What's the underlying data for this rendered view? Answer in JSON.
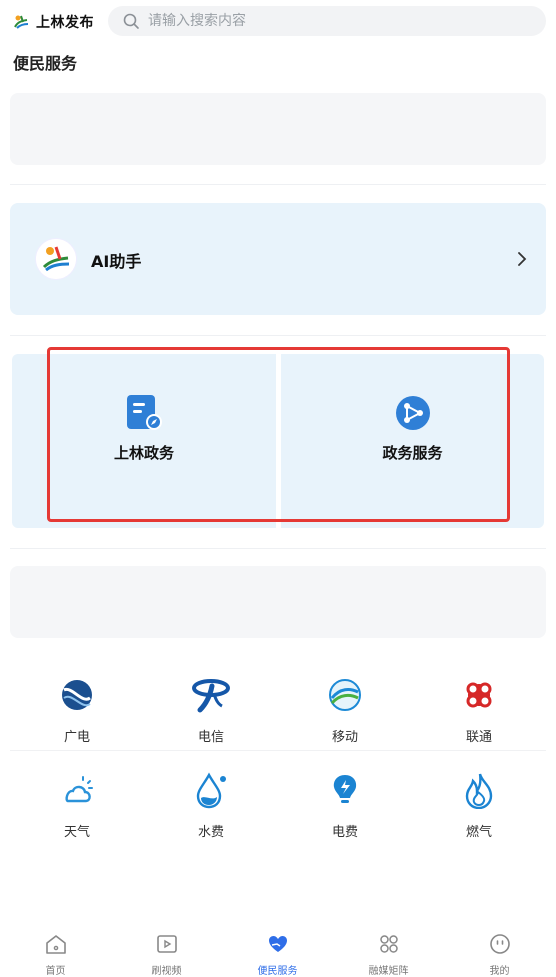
{
  "header": {
    "brand": "上林发布",
    "search_placeholder": "请输入搜索内容"
  },
  "section_title": "便民服务",
  "ai_card": {
    "label": "AI助手"
  },
  "services": [
    {
      "label": "上林政务",
      "icon": "document-compass-icon"
    },
    {
      "label": "政务服务",
      "icon": "share-network-icon"
    }
  ],
  "utilities_row1": [
    {
      "label": "广电",
      "icon": "broadcast-tv-icon"
    },
    {
      "label": "电信",
      "icon": "china-telecom-icon"
    },
    {
      "label": "移动",
      "icon": "china-mobile-icon"
    },
    {
      "label": "联通",
      "icon": "china-unicom-icon"
    }
  ],
  "utilities_row2": [
    {
      "label": "天气",
      "icon": "weather-cloud-icon"
    },
    {
      "label": "水费",
      "icon": "water-drop-icon"
    },
    {
      "label": "电费",
      "icon": "lightbulb-icon"
    },
    {
      "label": "燃气",
      "icon": "flame-icon"
    }
  ],
  "tabs": [
    {
      "label": "首页",
      "icon": "home-icon"
    },
    {
      "label": "刷视频",
      "icon": "video-play-icon"
    },
    {
      "label": "便民服务",
      "icon": "heart-hands-icon",
      "active": true
    },
    {
      "label": "融媒矩阵",
      "icon": "grid-flower-icon"
    },
    {
      "label": "我的",
      "icon": "smiley-icon"
    }
  ],
  "colors": {
    "accent": "#2f6ee8",
    "card_blue": "#e8f3fb",
    "card_grey": "#f5f6f8",
    "highlight_red": "#e53935"
  }
}
